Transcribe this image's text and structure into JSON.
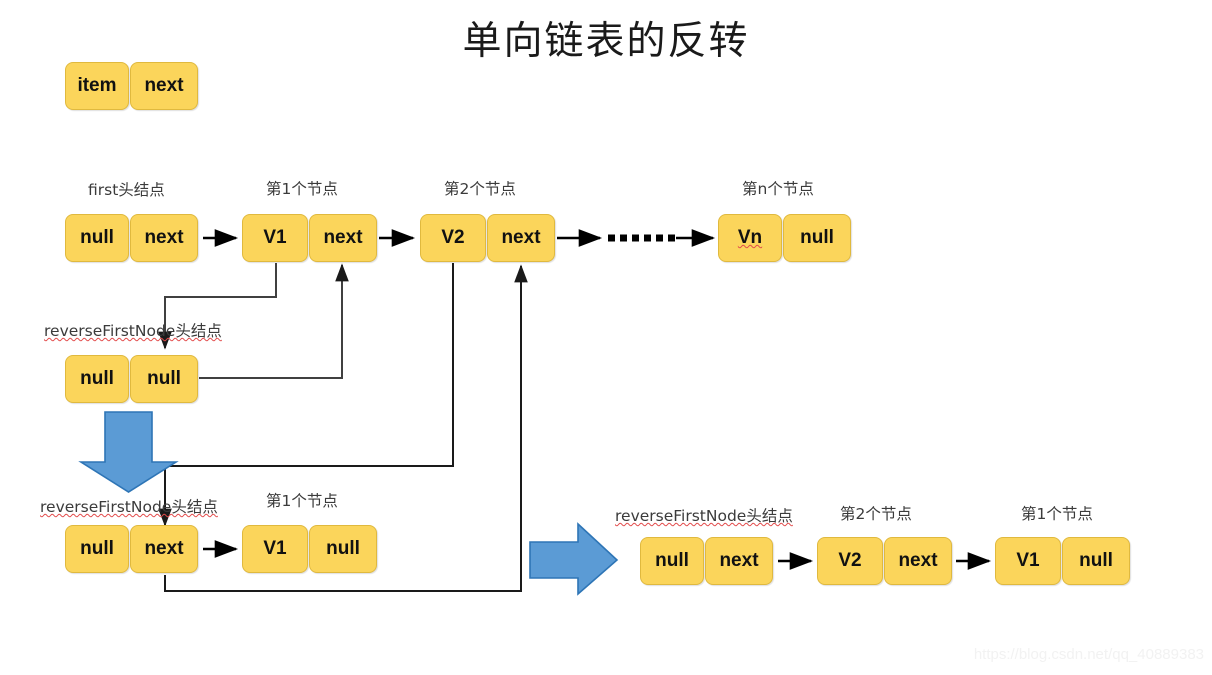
{
  "title": "单向链表的反转",
  "colors": {
    "node_fill": "#FBD55B",
    "node_border": "#E0B93E",
    "arrow_blue": "#5B9BD5",
    "arrow_blue_border": "#2E75B6",
    "connector": "#404040",
    "arrow_black": "#000000",
    "caption": "#3b3b3b",
    "spell_underline": "#e24a4a"
  },
  "legend": {
    "name": "node-legend",
    "cells": [
      "item",
      "next"
    ]
  },
  "rows": {
    "original_list": {
      "captions": [
        "first头结点",
        "第1个节点",
        "第2个节点",
        "第n个节点"
      ],
      "nodes": [
        {
          "name": "first-head-node",
          "cells": [
            "null",
            "next"
          ]
        },
        {
          "name": "node-v1",
          "cells": [
            "V1",
            "next"
          ]
        },
        {
          "name": "node-v2",
          "cells": [
            "V2",
            "next"
          ]
        },
        {
          "name": "node-vn",
          "cells": [
            "Vn",
            "null"
          ],
          "spellcheck_cell": 0
        }
      ],
      "ellipsis": "……"
    },
    "reverse_head_initial": {
      "caption": "reverseFirstNode头结点",
      "node": {
        "name": "reverse-head-node-initial",
        "cells": [
          "null",
          "null"
        ]
      }
    },
    "reverse_step": {
      "captions": [
        "reverseFirstNode头结点",
        "第1个节点"
      ],
      "nodes": [
        {
          "name": "reverse-head-node-step",
          "cells": [
            "null",
            "next"
          ]
        },
        {
          "name": "reversed-node-v1",
          "cells": [
            "V1",
            "null"
          ]
        }
      ]
    },
    "result_list": {
      "captions": [
        "reverseFirstNode头结点",
        "第2个节点",
        "第1个节点"
      ],
      "nodes": [
        {
          "name": "result-head-node",
          "cells": [
            "null",
            "next"
          ]
        },
        {
          "name": "result-node-v2",
          "cells": [
            "V2",
            "next"
          ]
        },
        {
          "name": "result-node-v1",
          "cells": [
            "V1",
            "null"
          ]
        }
      ]
    }
  },
  "arrows": {
    "blue_down": "blue-down-arrow",
    "blue_right": "blue-right-arrow"
  },
  "watermark": "https://blog.csdn.net/qq_40889383"
}
